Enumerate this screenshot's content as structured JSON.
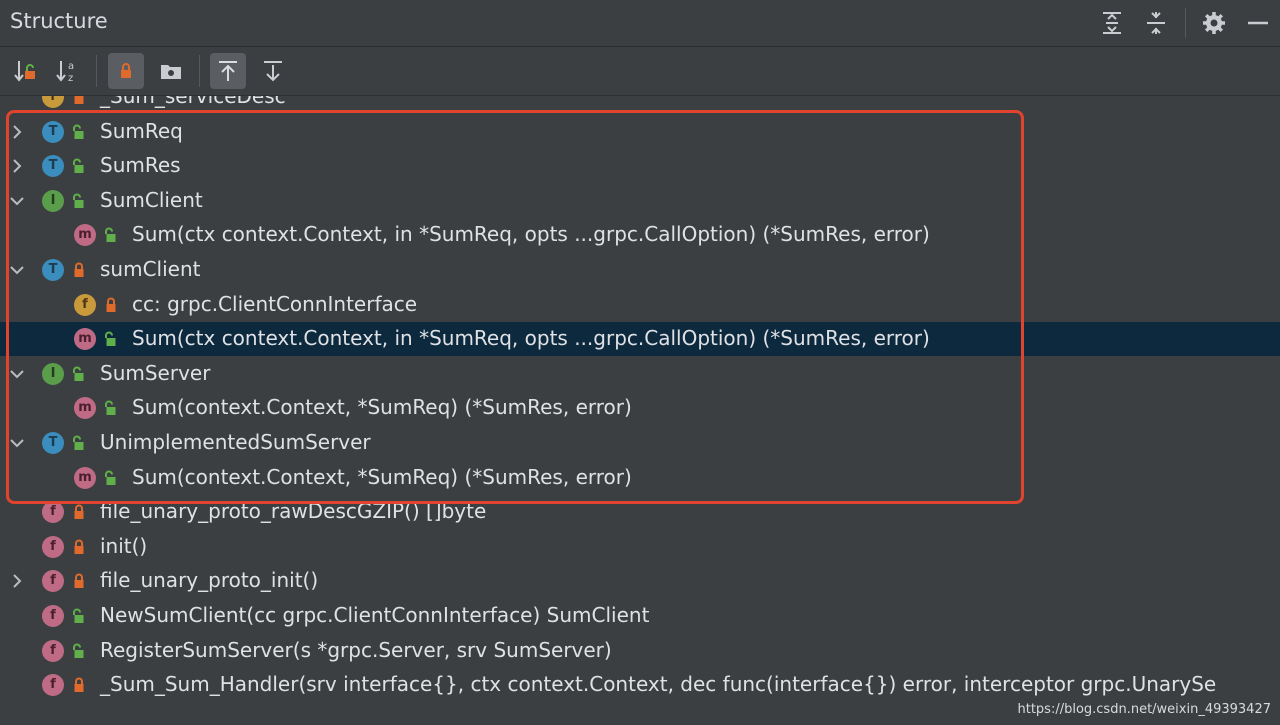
{
  "panel": {
    "title": "Structure"
  },
  "title_actions": [
    {
      "name": "expand-all-icon"
    },
    {
      "name": "collapse-all-icon"
    },
    {
      "name": "gear-icon"
    },
    {
      "name": "hide-icon"
    }
  ],
  "toolbar": {
    "buttons": [
      {
        "name": "sort-by-visibility-icon",
        "active": false
      },
      {
        "name": "sort-alphabetically-icon",
        "active": false
      },
      {
        "name": "show-non-public-icon",
        "active": true
      },
      {
        "name": "show-fields-icon",
        "active": false
      },
      {
        "name": "autoscroll-to-source-icon",
        "active": true
      },
      {
        "name": "autoscroll-from-source-icon",
        "active": false
      }
    ]
  },
  "tree": {
    "rows": [
      {
        "label": "_Sum_serviceDesc",
        "kind": "f",
        "access": "private",
        "chevron": "none",
        "indent": 0,
        "partial": true
      },
      {
        "label": "SumReq",
        "kind": "T",
        "access": "public",
        "chevron": "right",
        "indent": 0
      },
      {
        "label": "SumRes",
        "kind": "T",
        "access": "public",
        "chevron": "right",
        "indent": 0
      },
      {
        "label": "SumClient",
        "kind": "I",
        "access": "public",
        "chevron": "down",
        "indent": 0
      },
      {
        "label": "Sum(ctx context.Context, in *SumReq, opts ...grpc.CallOption) (*SumRes, error)",
        "kind": "m",
        "access": "public",
        "chevron": "none",
        "indent": 1
      },
      {
        "label": "sumClient",
        "kind": "T",
        "access": "private",
        "chevron": "down",
        "indent": 0
      },
      {
        "label": "cc: grpc.ClientConnInterface",
        "kind": "f",
        "access": "private",
        "chevron": "none",
        "indent": 1
      },
      {
        "label": "Sum(ctx context.Context, in *SumReq, opts ...grpc.CallOption) (*SumRes, error)",
        "kind": "m",
        "access": "public",
        "chevron": "none",
        "indent": 1,
        "selected": true
      },
      {
        "label": "SumServer",
        "kind": "I",
        "access": "public",
        "chevron": "down",
        "indent": 0
      },
      {
        "label": "Sum(context.Context, *SumReq) (*SumRes, error)",
        "kind": "m",
        "access": "public",
        "chevron": "none",
        "indent": 1
      },
      {
        "label": "UnimplementedSumServer",
        "kind": "T",
        "access": "public",
        "chevron": "down",
        "indent": 0
      },
      {
        "label": "Sum(context.Context, *SumReq) (*SumRes, error)",
        "kind": "m",
        "access": "public",
        "chevron": "none",
        "indent": 1
      },
      {
        "label": "file_unary_proto_rawDescGZIP() []byte",
        "kind": "fp",
        "access": "private",
        "chevron": "none",
        "indent": 0
      },
      {
        "label": "init()",
        "kind": "fp",
        "access": "private",
        "chevron": "none",
        "indent": 0
      },
      {
        "label": "file_unary_proto_init()",
        "kind": "fp",
        "access": "private",
        "chevron": "right",
        "indent": 0
      },
      {
        "label": "NewSumClient(cc grpc.ClientConnInterface) SumClient",
        "kind": "fp",
        "access": "public",
        "chevron": "none",
        "indent": 0
      },
      {
        "label": "RegisterSumServer(s *grpc.Server, srv SumServer)",
        "kind": "fp",
        "access": "public",
        "chevron": "none",
        "indent": 0
      },
      {
        "label": "_Sum_Sum_Handler(srv interface{}, ctx context.Context, dec func(interface{}) error, interceptor grpc.UnarySe",
        "kind": "fp",
        "access": "private",
        "chevron": "none",
        "indent": 0
      }
    ]
  },
  "watermark": "https://blog.csdn.net/weixin_49393427",
  "colors": {
    "highlight_box": "#e2432f",
    "selection": "#0d293e",
    "lock_private": "#e06a2c",
    "lock_public": "#5fb04a"
  }
}
